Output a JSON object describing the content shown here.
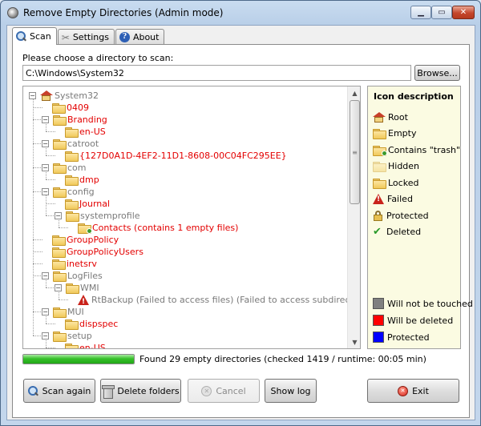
{
  "window": {
    "title": "Remove Empty Directories (Admin mode)",
    "min_glyph": "▁",
    "max_glyph": "▭",
    "close_glyph": "✕"
  },
  "tabs": [
    {
      "label": "Scan",
      "icon": "magnifier-icon",
      "active": true
    },
    {
      "label": "Settings",
      "icon": "tools-icon",
      "active": false
    },
    {
      "label": "About",
      "icon": "info-icon",
      "active": false
    }
  ],
  "scan": {
    "prompt": "Please choose a directory to scan:",
    "path": "C:\\Windows\\System32",
    "browse_label": "Browse..."
  },
  "tree": [
    {
      "label": "System32",
      "color": "gray",
      "icon": "root"
    },
    {
      "label": "0409",
      "color": "red",
      "icon": "folder"
    },
    {
      "label": "Branding",
      "color": "red",
      "icon": "folder"
    },
    {
      "label": "en-US",
      "color": "red",
      "icon": "folder"
    },
    {
      "label": "catroot",
      "color": "gray",
      "icon": "folder"
    },
    {
      "label": "{127D0A1D-4EF2-11D1-8608-00C04FC295EE}",
      "color": "red",
      "icon": "folder"
    },
    {
      "label": "com",
      "color": "gray",
      "icon": "folder"
    },
    {
      "label": "dmp",
      "color": "red",
      "icon": "folder"
    },
    {
      "label": "config",
      "color": "gray",
      "icon": "folder"
    },
    {
      "label": "Journal",
      "color": "red",
      "icon": "folder"
    },
    {
      "label": "systemprofile",
      "color": "gray",
      "icon": "folder"
    },
    {
      "label": "Contacts (contains 1 empty files)",
      "color": "red",
      "icon": "trash"
    },
    {
      "label": "GroupPolicy",
      "color": "red",
      "icon": "folder"
    },
    {
      "label": "GroupPolicyUsers",
      "color": "red",
      "icon": "folder"
    },
    {
      "label": "inetsrv",
      "color": "red",
      "icon": "folder"
    },
    {
      "label": "LogFiles",
      "color": "gray",
      "icon": "folder"
    },
    {
      "label": "WMI",
      "color": "gray",
      "icon": "folder"
    },
    {
      "label": "RtBackup (Failed to access files) (Failed to access subdirectories)",
      "color": "gray",
      "icon": "failed"
    },
    {
      "label": "MUI",
      "color": "gray",
      "icon": "folder"
    },
    {
      "label": "dispspec",
      "color": "red",
      "icon": "folder"
    },
    {
      "label": "setup",
      "color": "gray",
      "icon": "folder"
    },
    {
      "label": "en-US",
      "color": "red",
      "icon": "folder"
    }
  ],
  "legend": {
    "title": "Icon description",
    "icons": [
      {
        "label": "Root",
        "icon": "root"
      },
      {
        "label": "Empty",
        "icon": "folder"
      },
      {
        "label": "Contains \"trash\"",
        "icon": "trash"
      },
      {
        "label": "Hidden",
        "icon": "hidden"
      },
      {
        "label": "Locked",
        "icon": "locked"
      },
      {
        "label": "Failed",
        "icon": "failed"
      },
      {
        "label": "Protected",
        "icon": "protected"
      },
      {
        "label": "Deleted",
        "icon": "deleted"
      }
    ],
    "colors": [
      {
        "label": "Will not be touched",
        "color": "#808080"
      },
      {
        "label": "Will be deleted",
        "color": "#ff0000"
      },
      {
        "label": "Protected",
        "color": "#0000ff"
      }
    ]
  },
  "status": {
    "progress": 1.0,
    "text": "Found 29 empty directories (checked 1419 / runtime: 00:05 min)"
  },
  "actions": {
    "scan_again": "Scan again",
    "delete_folders": "Delete folders",
    "cancel": "Cancel",
    "show_log": "Show log",
    "exit": "Exit"
  },
  "colors": {
    "will_not_be_touched": "#808080",
    "will_be_deleted": "#e30000",
    "protected": "#0000ff",
    "legend_bg": "#fbfbe2"
  }
}
